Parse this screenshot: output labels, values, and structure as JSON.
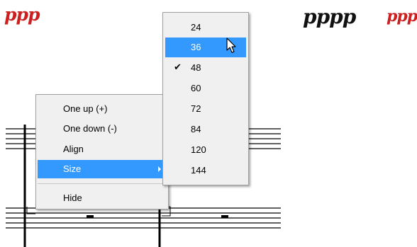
{
  "dynamics": {
    "left": "ppp",
    "center_right": "pppp",
    "far_right": "ppp"
  },
  "context_menu": {
    "items": [
      "One up (+)",
      "One down (-)",
      "Align",
      "Size"
    ],
    "highlighted_item": "Size",
    "after_separator": "Hide"
  },
  "size_submenu": {
    "options": [
      "24",
      "36",
      "48",
      "60",
      "72",
      "84",
      "120",
      "144"
    ],
    "highlighted": "36",
    "checked": "48"
  },
  "colors": {
    "highlight": "#3399ff",
    "dynamic_red": "#cc1f1f",
    "menu_bg": "#f0f0f0"
  }
}
